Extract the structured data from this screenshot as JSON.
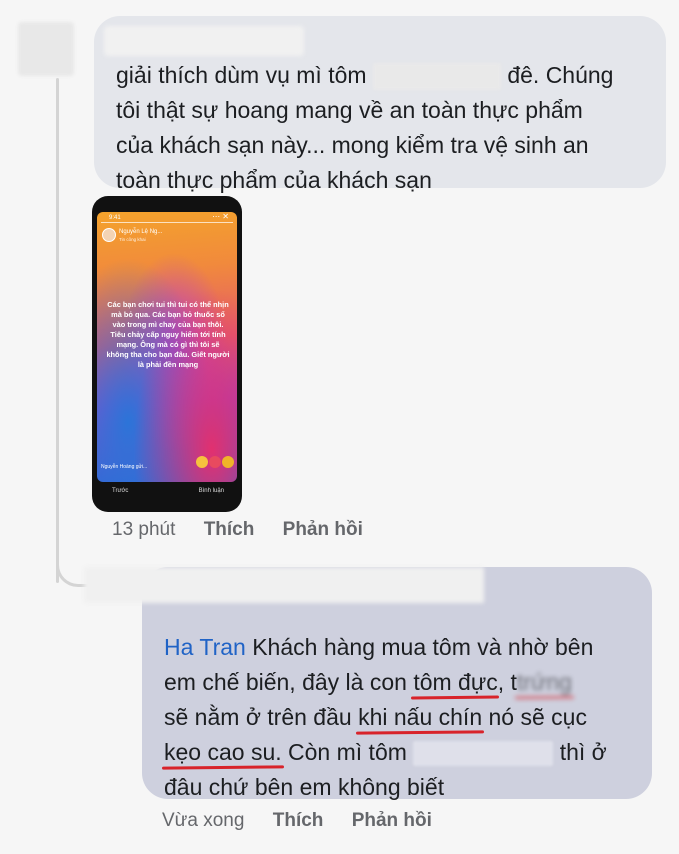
{
  "comment1": {
    "text_a": "giải thích dùm vụ mì tôm",
    "text_b": "đê. Chúng",
    "line2": "tôi thật sự hoang mang về an toàn thực phẩm",
    "line3": "của khách sạn này... mong kiểm tra vệ sinh an",
    "line4": "toàn thực phẩm của khách sạn",
    "actions": {
      "time": "13 phút",
      "like": "Thích",
      "reply": "Phản hồi"
    }
  },
  "story": {
    "status_time": "9:41",
    "author": "Nguyễn Lệ Ng...",
    "subtitle": "Tin công khai",
    "text": "Các bạn chơi tui thì tui có thể nhịn mà bỏ qua. Các bạn bỏ thuốc sổ vào trong mì chay của bạn thôi. Tiêu chảy cấp nguy hiểm tới tính mạng. Ông mà có gì thì tôi sẽ không tha cho bạn đâu. Giết người là phải đền mạng",
    "reply_placeholder": "Nguyễn Hoàng gửi...",
    "nav_left": "Trước",
    "nav_right": "Bình luận"
  },
  "comment2": {
    "mention": "Ha Tran",
    "l1_rest": " Khách hàng mua tôm và nhờ bên",
    "l2_a": "em chế biến, đây là con ",
    "l2_ul": "tôm đực",
    "l2_b": ", t",
    "l2_blur": "trứng",
    "l3_a": "sẽ nằm ở trên đầu ",
    "l3_ul": "khi nấu chín",
    "l3_b": " nó sẽ cục",
    "l4_ul": "kẹo cao su.",
    "l4_a": " Còn mì tôm",
    "l4_b": "thì ở",
    "l5": "đâu chứ bên em không biết",
    "actions": {
      "time": "Vừa xong",
      "like": "Thích",
      "reply": "Phản hồi"
    }
  },
  "colors": {
    "bubble1": "#e4e6eb",
    "bubble2": "#ced0de",
    "mention": "#2063c6",
    "underline": "#d8232a",
    "meta": "#65676b"
  }
}
